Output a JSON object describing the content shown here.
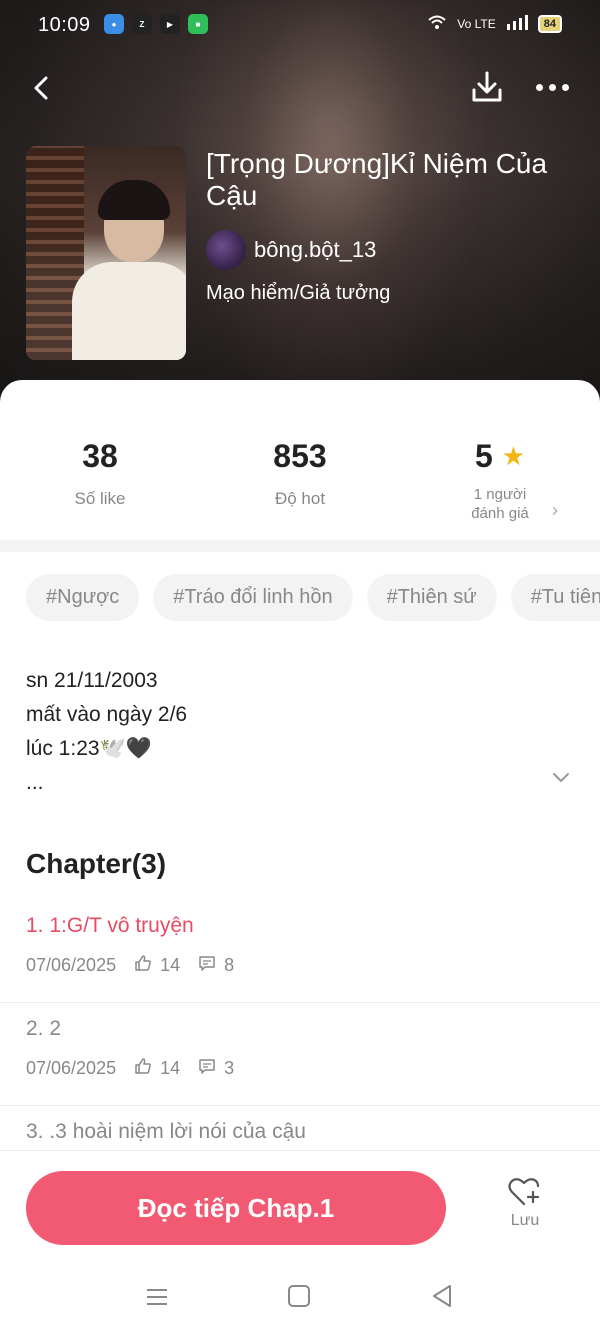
{
  "status_bar": {
    "time": "10:09",
    "apps": [
      "messenger-icon",
      "zalo-icon",
      "youtube-icon",
      "messages-icon"
    ],
    "network": "Vo LTE",
    "battery": "84"
  },
  "header": {
    "title": "[Trọng Dương]Kỉ Niệm Của Cậu",
    "author": "bông.bột_13",
    "genre": "Mạo hiểm/Giả tưởng"
  },
  "stats": {
    "likes_value": "38",
    "likes_label": "Số like",
    "hot_value": "853",
    "hot_label": "Độ hot",
    "rating_value": "5",
    "rating_label_line1": "1 người",
    "rating_label_line2": "đánh giá"
  },
  "tags": [
    "#Ngược",
    "#Tráo đổi linh hồn",
    "#Thiên sứ",
    "#Tu tiên"
  ],
  "description": {
    "line1": "sn 21/11/2003",
    "line2": "mất vào ngày 2/6",
    "line3": "lúc 1:23🕊️🖤",
    "line4": "..."
  },
  "chapters": {
    "heading": "Chapter(3)",
    "items": [
      {
        "name": "1. 1:G/T vô truyện",
        "date": "07/06/2025",
        "likes": "14",
        "comments": "8"
      },
      {
        "name": "2. 2",
        "date": "07/06/2025",
        "likes": "14",
        "comments": "3"
      },
      {
        "name": "3. .3 hoài niệm lời nói của cậu"
      }
    ]
  },
  "actions": {
    "read_button": "Đọc tiếp Chap.1",
    "save_label": "Lưu"
  },
  "colors": {
    "accent": "#f25a73",
    "active_chapter": "#e94a64",
    "star": "#f3b515"
  }
}
